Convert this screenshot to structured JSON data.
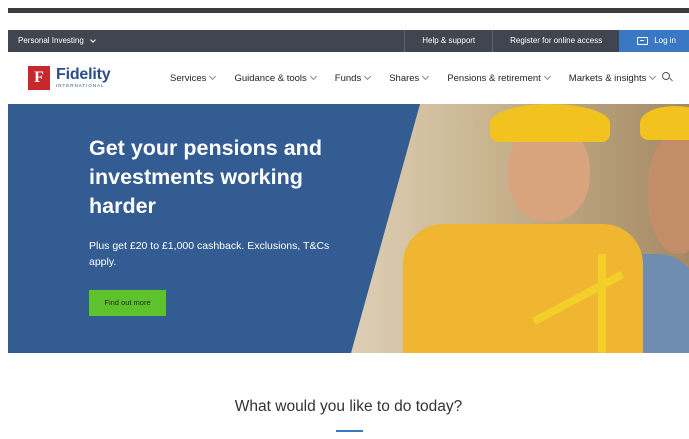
{
  "utility_bar": {
    "segment_label": "Personal Investing",
    "help": "Help & support",
    "register": "Register for online access",
    "login": "Log in"
  },
  "brand": {
    "logo_letter": "F",
    "name": "Fidelity",
    "subtitle": "INTERNATIONAL",
    "color": "#c7282c"
  },
  "nav": {
    "items": [
      {
        "label": "Services"
      },
      {
        "label": "Guidance & tools"
      },
      {
        "label": "Funds"
      },
      {
        "label": "Shares"
      },
      {
        "label": "Pensions & retirement"
      },
      {
        "label": "Markets & insights"
      }
    ]
  },
  "hero": {
    "title": "Get your pensions and investments working harder",
    "subtitle": "Plus get £20 to £1,000 cashback. Exclusions, T&Cs apply.",
    "cta": "Find out more",
    "cta_color": "#5ec22d",
    "panel_color": "#335c93"
  },
  "section": {
    "title": "What would you like to do today?"
  },
  "colors": {
    "accent": "#3a78c3",
    "utility_bg": "#3f4650"
  }
}
